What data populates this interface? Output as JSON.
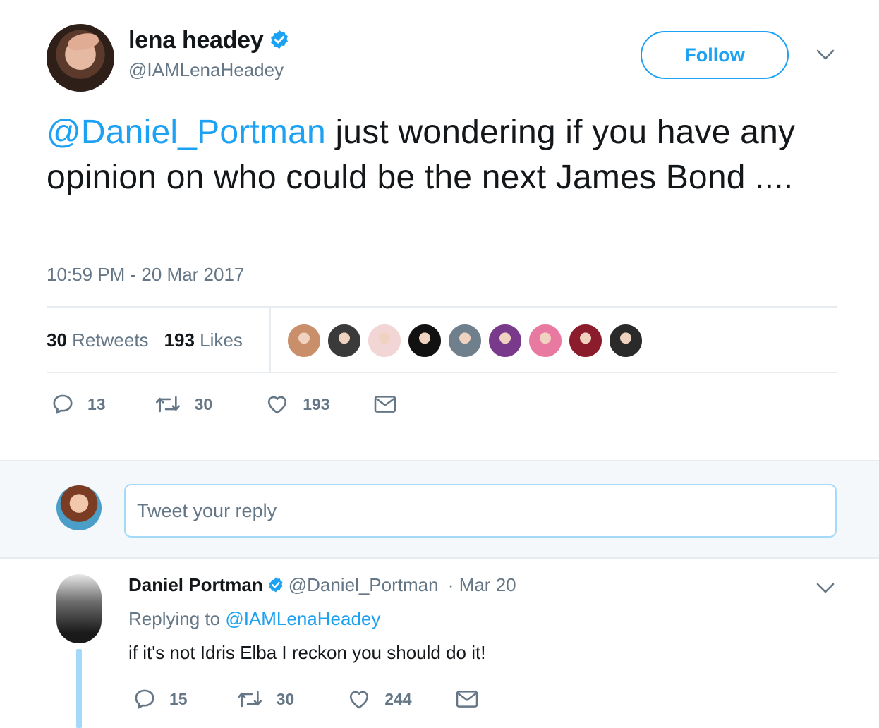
{
  "main_tweet": {
    "author_name": "lena headey",
    "author_handle": "@IAMLenaHeadey",
    "follow_label": "Follow",
    "text_mention": "@Daniel_Portman",
    "text_body": " just wondering if you have any opinion on who could be the next James Bond ....",
    "timestamp": "10:59 PM - 20 Mar 2017",
    "retweets_count": "30",
    "retweets_label": "Retweets",
    "likes_count": "193",
    "likes_label": "Likes",
    "likers": [
      "#c98f6b",
      "#3a3a3a",
      "#f2d5d5",
      "#111111",
      "#6f7f8c",
      "#7a3a8c",
      "#e87aa2",
      "#8b1c2c",
      "#2a2a2a"
    ],
    "actions": {
      "replies": "13",
      "retweets": "30",
      "likes": "193"
    }
  },
  "reply_box": {
    "placeholder": "Tweet your reply"
  },
  "reply_tweet": {
    "author_name": "Daniel Portman",
    "author_handle": "@Daniel_Portman",
    "separator": "·",
    "date": "Mar 20",
    "replying_prefix": "Replying to",
    "replying_to": "@IAMLenaHeadey",
    "text": "if it's not Idris Elba I reckon you should do it!",
    "actions": {
      "replies": "15",
      "retweets": "30",
      "likes": "244"
    }
  },
  "colors": {
    "accent": "#1da1f2",
    "muted": "#657786",
    "text": "#14171a",
    "divider": "#e6ecf0"
  },
  "icons": [
    "verified-badge-icon",
    "chevron-down-icon",
    "reply-icon",
    "retweet-icon",
    "heart-icon",
    "mail-icon"
  ]
}
